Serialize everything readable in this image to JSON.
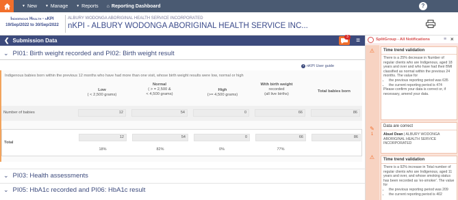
{
  "nav": {
    "items": [
      {
        "label": "New",
        "has_caret": true
      },
      {
        "label": "Manage",
        "has_caret": true
      },
      {
        "label": "Reports",
        "has_caret": true
      },
      {
        "label": "Reporting Dashboard",
        "has_caret": false
      }
    ],
    "help": "?"
  },
  "header": {
    "org_short": "Indigenous Health - nKPI",
    "period": "19/Sep/2022 to 30/Sep/2022",
    "org_sub": "ALBURY WODONGA ABORIGINAL HEALTH SERVICE INCORPORATED",
    "title": "nKPI - ALBURY WODONGA ABORIGINAL HEALTH SERVICE INC..."
  },
  "submission": {
    "label": "Submission Data",
    "notification_count": "3"
  },
  "sections": {
    "pi01_title": "PI01: Birth weight recorded and PI02: Birth weight result",
    "pi03_title": "PI03: Health assessments",
    "pi05_title": "PI05: HbA1c recorded and PI06: HbA1c result"
  },
  "guide_label": "nKPI User guide",
  "table": {
    "description": "Indigenous babies born within the previous 12 months who have had more than one visit, whose birth weight results were low, normal or high",
    "headers": [
      {
        "line1": "Low",
        "line2": "( < 2,500 grams)"
      },
      {
        "line1": "Normal",
        "line2": "( > = 2,500 &",
        "line3": "< 4,500 grams)"
      },
      {
        "line1": "High",
        "line2": "(>= 4,500 grams)"
      },
      {
        "line1": "With birth weight",
        "line2": "recorded",
        "line3": "(all live births)"
      },
      {
        "line1": "Total babies born"
      }
    ],
    "row1_label": "Number of babies",
    "row1_values": [
      "12",
      "54",
      "0",
      "66",
      "86"
    ],
    "total_label": "Total",
    "total_values": [
      "12",
      "54",
      "0",
      "66",
      "86"
    ],
    "percents": [
      "18%",
      "82%",
      "0%",
      "77%"
    ]
  },
  "notifications": {
    "title": "SplitGroup - All Notifications",
    "card1": {
      "title": "Time trend validation",
      "text": "There is a 25% decrease in Number of regular clients who are Indigenous, aged 18 years and over and who have had their BMI classified as normal within the previous 24 months. The value for",
      "bullets": [
        "the previous reporting period was 635",
        "the current reporting period is 474"
      ],
      "text2": "Please confirm your data is correct or, if necessary, amend your data."
    },
    "card2": {
      "title": "Data are correct",
      "author": "Abuel Dean",
      "org": "ALBURY WODONGA ABORIGINAL HEALTH SERVICE INCORPORATED"
    },
    "card3": {
      "title": "Time trend validation",
      "text": "There is a 92% increase in Total number of regular clients who are Indigenous, aged 11 years and over, and whose smoking status has been recorded as 'ex-smoker'. The value for",
      "bullets": [
        "the previous reporting period was 209",
        "the current reporting period is 402"
      ]
    },
    "rail_count": "1"
  }
}
